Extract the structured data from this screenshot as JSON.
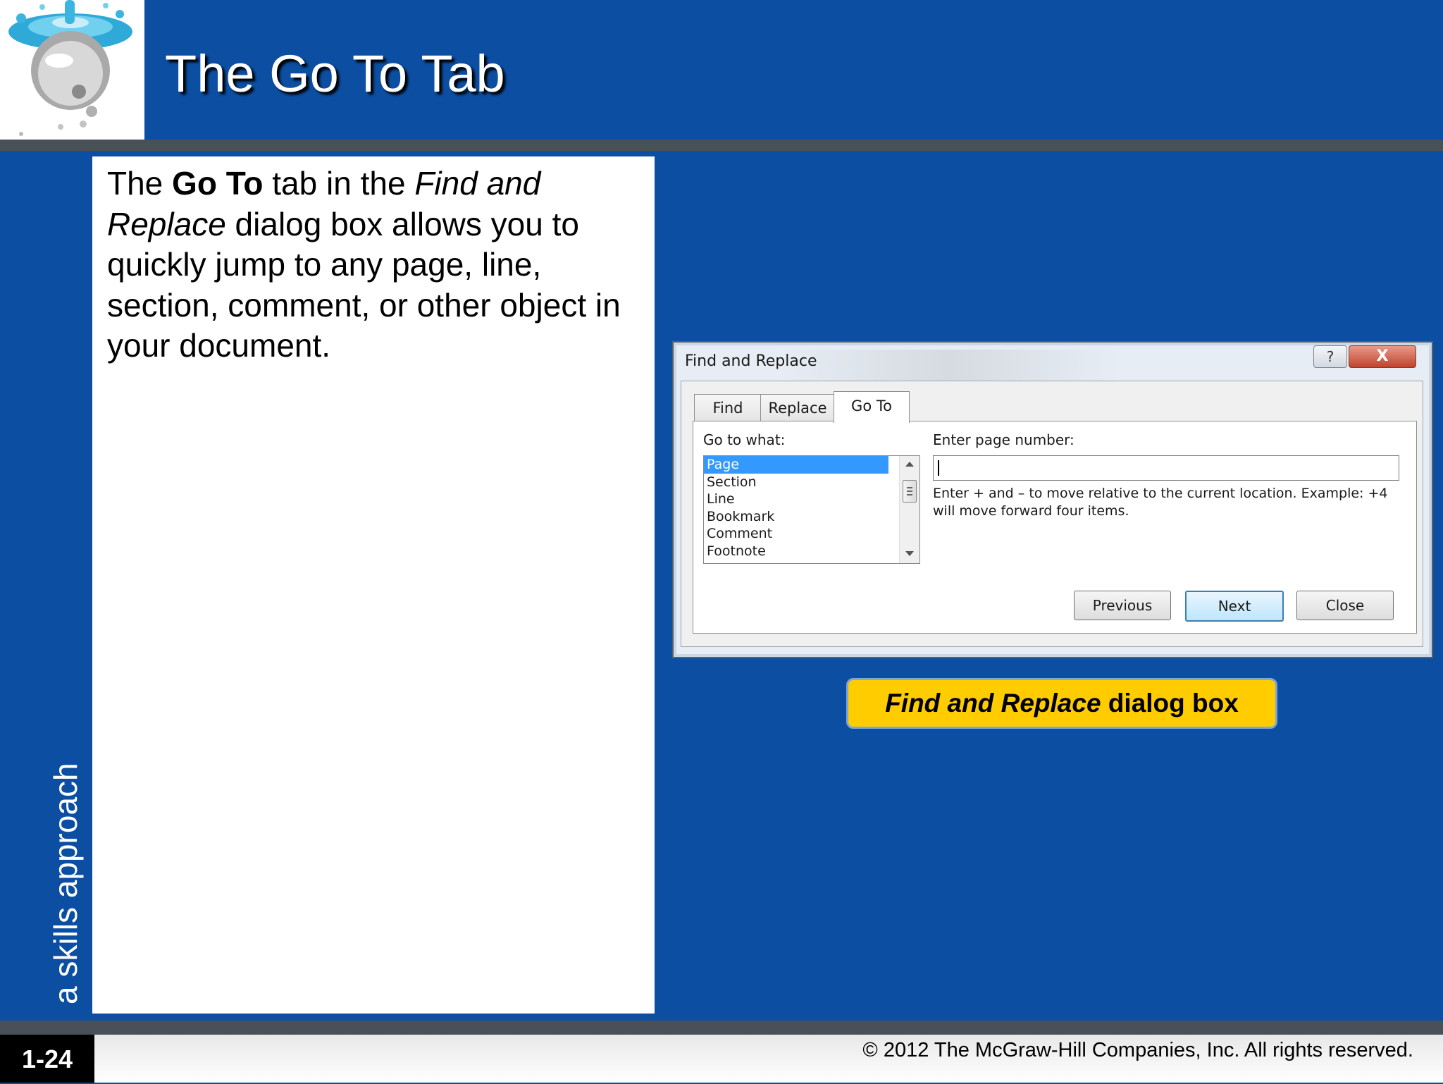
{
  "slide": {
    "title": "The Go To Tab",
    "side_label": "a skills approach",
    "body": {
      "t1": "The ",
      "t2": "Go To",
      "t3": " tab in the ",
      "t4": "Find and Replace",
      "t5": " dialog box allows you to quickly jump to any page, line, section, comment, or other object in your document."
    },
    "caption_italic": "Find and Replace",
    "caption_rest": " dialog box",
    "page_number": "1-24",
    "copyright": "© 2012 The McGraw-Hill Companies, Inc. All rights reserved."
  },
  "dialog": {
    "title": "Find and Replace",
    "help_label": "?",
    "close_label": "X",
    "tabs": [
      "Find",
      "Replace",
      "Go To"
    ],
    "go_to_what_label": "Go to what:",
    "list_items": [
      "Page",
      "Section",
      "Line",
      "Bookmark",
      "Comment",
      "Footnote"
    ],
    "enter_label": "Enter page number:",
    "input_value": "",
    "hint": "Enter + and – to move relative to the current location. Example: +4 will move forward four items.",
    "buttons": {
      "previous": "Previous",
      "next": "Next",
      "close": "Close"
    }
  },
  "colors": {
    "slide_background": "#0b4ea2",
    "caption_background": "#ffcc00",
    "selection": "#3399ff"
  }
}
